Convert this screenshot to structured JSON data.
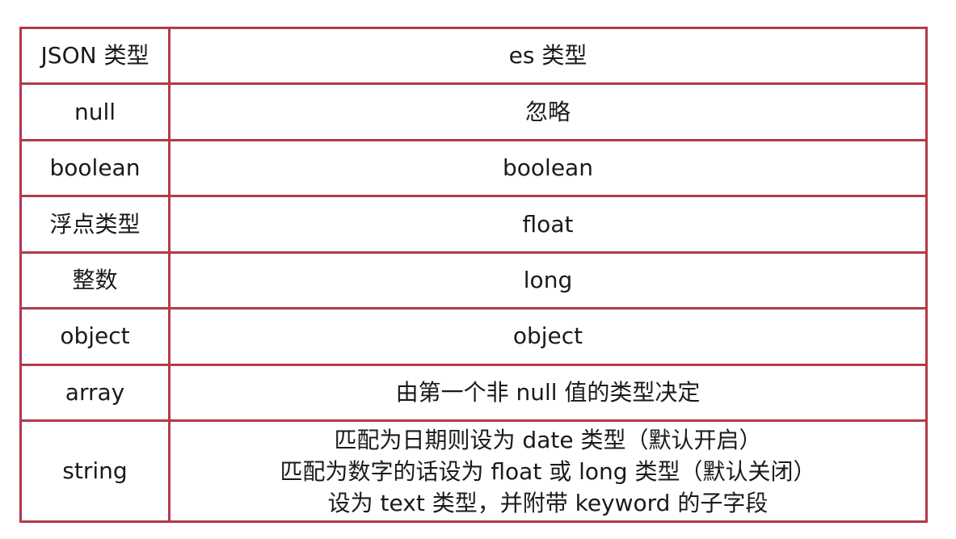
{
  "table": {
    "header": {
      "json_type": "JSON 类型",
      "es_type": "es 类型"
    },
    "rows": [
      {
        "json_type": "null",
        "es_type": "忽略"
      },
      {
        "json_type": "boolean",
        "es_type": "boolean"
      },
      {
        "json_type": "浮点类型",
        "es_type": "float"
      },
      {
        "json_type": "整数",
        "es_type": "long"
      },
      {
        "json_type": "object",
        "es_type": "object"
      },
      {
        "json_type": "array",
        "es_type": "由第一个非 null 值的类型决定"
      }
    ],
    "string_row": {
      "json_type": "string",
      "es_lines": [
        "匹配为日期则设为 date 类型（默认开启）",
        "匹配为数字的话设为 float 或 long 类型（默认关闭）",
        "设为 text 类型，并附带 keyword 的子字段"
      ]
    }
  },
  "colors": {
    "border": "#b23a4a",
    "text": "#1a1a1a",
    "background": "#ffffff"
  }
}
